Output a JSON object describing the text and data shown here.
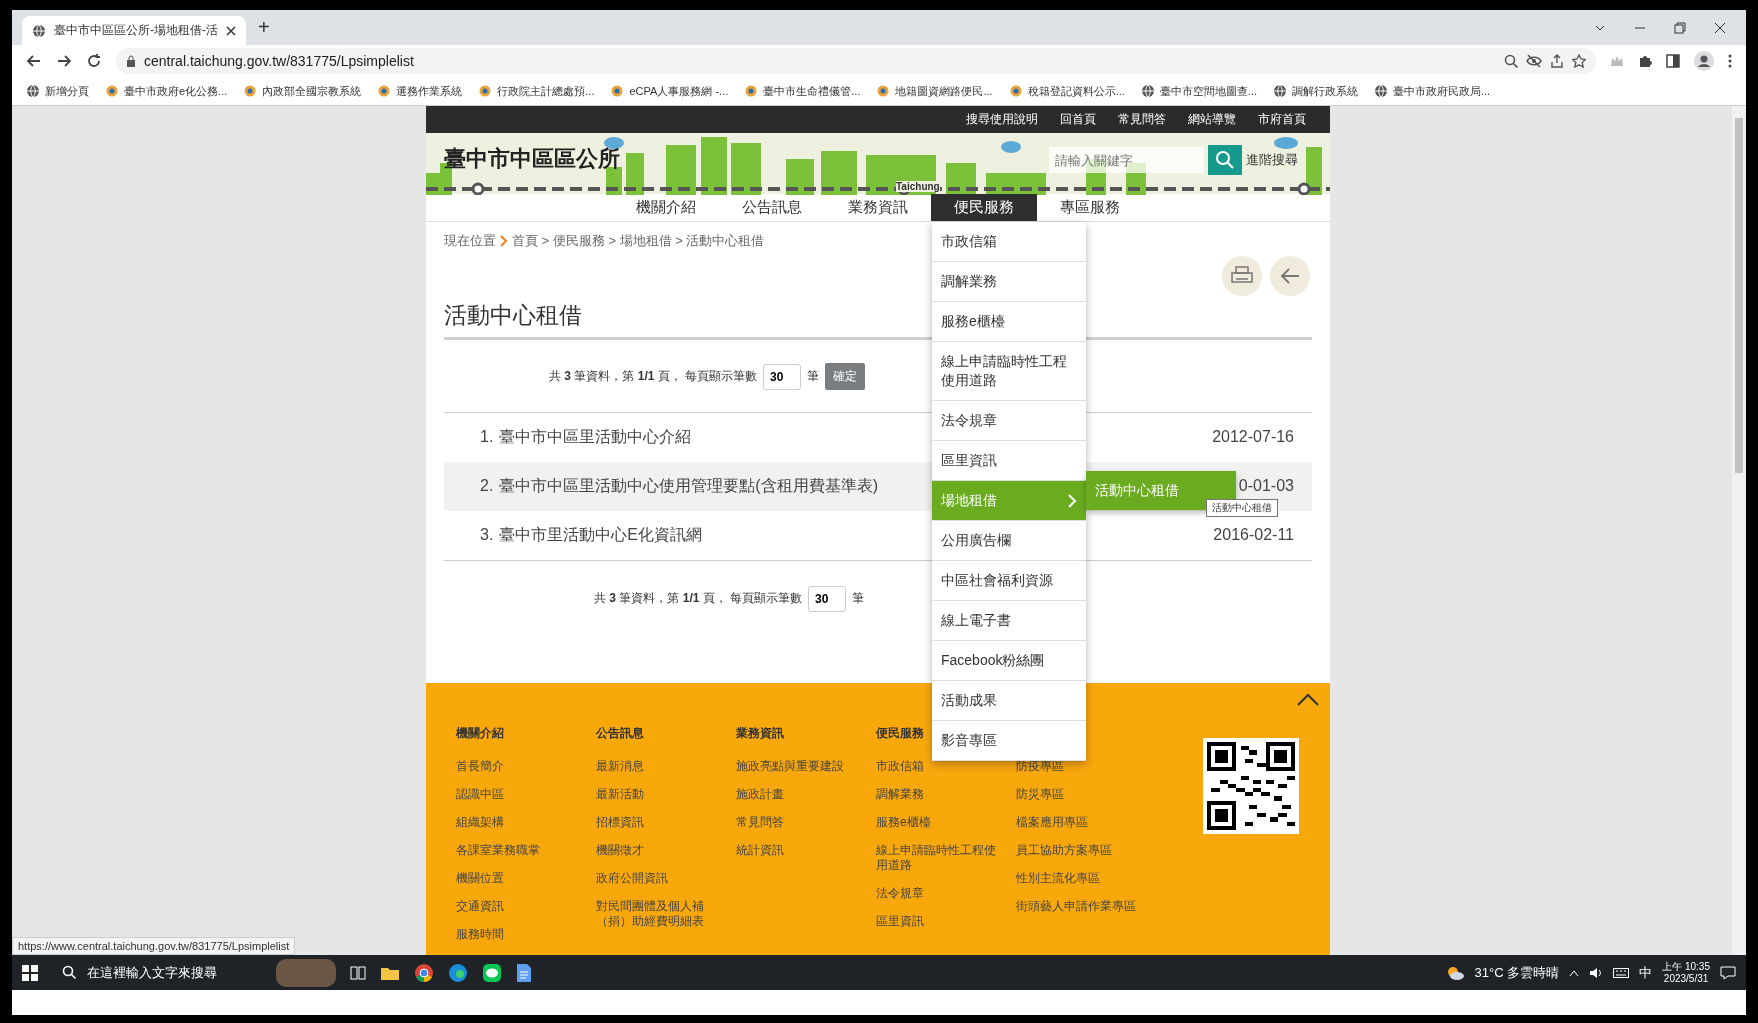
{
  "browser": {
    "tab_title": "臺中市中區區公所-場地租借-活",
    "new_tab": "+",
    "url": "central.taichung.gov.tw/831775/Lpsimplelist",
    "bookmarks": [
      {
        "label": "新增分頁",
        "kind": "globe"
      },
      {
        "label": "臺中市政府e化公務...",
        "kind": "logo"
      },
      {
        "label": "內政部全國宗教系統",
        "kind": "logo"
      },
      {
        "label": "選務作業系統",
        "kind": "logo"
      },
      {
        "label": "行政院主計總處預...",
        "kind": "logo"
      },
      {
        "label": "eCPA人事服務網 -...",
        "kind": "logo"
      },
      {
        "label": "臺中市生命禮儀管...",
        "kind": "logo"
      },
      {
        "label": "地籍圖資網路便民...",
        "kind": "logo"
      },
      {
        "label": "稅籍登記資料公示...",
        "kind": "logo"
      },
      {
        "label": "臺中市空間地圖查...",
        "kind": "globe"
      },
      {
        "label": "調解行政系統",
        "kind": "globe"
      },
      {
        "label": "臺中市政府民政局...",
        "kind": "globe"
      }
    ],
    "status_url": "https://www.central.taichung.gov.tw/831775/Lpsimplelist"
  },
  "site": {
    "top_links": [
      "搜尋使用說明",
      "回首頁",
      "常見問答",
      "網站導覽",
      "市府首頁"
    ],
    "title": "臺中市中區區公所",
    "rail_label": "Taichung",
    "search": {
      "placeholder": "請輸入關鍵字"
    },
    "advanced_search": "進階搜尋",
    "nav": [
      {
        "label": "機關介紹",
        "selected": false
      },
      {
        "label": "公告訊息",
        "selected": false
      },
      {
        "label": "業務資訊",
        "selected": false
      },
      {
        "label": "便民服務",
        "selected": true
      },
      {
        "label": "專區服務",
        "selected": false
      }
    ],
    "dropdown": [
      {
        "label": "市政信箱",
        "selected": false
      },
      {
        "label": "調解業務",
        "selected": false
      },
      {
        "label": "服務e櫃檯",
        "selected": false
      },
      {
        "label": "線上申請臨時性工程使用道路",
        "selected": false
      },
      {
        "label": "法令規章",
        "selected": false
      },
      {
        "label": "區里資訊",
        "selected": false
      },
      {
        "label": "場地租借",
        "selected": true,
        "submenu": [
          "活動中心租借"
        ],
        "tooltip": "活動中心租借"
      },
      {
        "label": "公用廣告欄",
        "selected": false
      },
      {
        "label": "中區社會福利資源",
        "selected": false
      },
      {
        "label": "線上電子書",
        "selected": false
      },
      {
        "label": "Facebook粉絲團",
        "selected": false
      },
      {
        "label": "活動成果",
        "selected": false
      },
      {
        "label": "影音專區",
        "selected": false
      }
    ],
    "breadcrumb": {
      "label": "現在位置",
      "path": "首頁 > 便民服務 > 場地租借 > 活動中心租借"
    },
    "page_title": "活動中心租借",
    "pager_top": {
      "summary": "共 **3** 筆資料，第 **1/1** 頁， 每頁顯示筆數",
      "page_size": "30",
      "unit": "筆",
      "confirm": "確定"
    },
    "rows": [
      {
        "number": "1.",
        "title": "臺中市中區里活動中心介紹",
        "date": "2012-07-16",
        "shaded": false
      },
      {
        "number": "2.",
        "title": "臺中市中區里活動中心使用管理要點(含租用費基準表)",
        "date": "0-01-03",
        "shaded": true
      },
      {
        "number": "3.",
        "title": "臺中市里活動中心E化資訊網",
        "date": "2016-02-11",
        "shaded": false
      }
    ],
    "pager_bottom": {
      "summary": "共 **3** 筆資料，第 **1/1** 頁， 每頁顯示筆數",
      "page_size": "30",
      "unit": "筆"
    },
    "footer": {
      "columns": [
        {
          "heading": "機關介紹",
          "items": [
            "首長簡介",
            "認識中區",
            "組織架構",
            "各課室業務職掌",
            "機關位置",
            "交通資訊",
            "服務時間"
          ]
        },
        {
          "heading": "公告訊息",
          "items": [
            "最新消息",
            "最新活動",
            "招標資訊",
            "機關徵才",
            "政府公開資訊",
            "對民間團體及個人補（捐）助經費明細表"
          ]
        },
        {
          "heading": "業務資訊",
          "items": [
            "施政亮點與重要建設",
            "施政計畫",
            "常見問答",
            "統計資訊"
          ]
        },
        {
          "heading": "便民服務",
          "items": [
            "市政信箱",
            "調解業務",
            "服務e櫃檯",
            "線上申請臨時性工程使用道路",
            "法令規章",
            "區里資訊"
          ]
        },
        {
          "items": [
            "防疫專區",
            "防災專區",
            "檔案應用專區",
            "員工協助方案專區",
            "性別主流化專區",
            "街頭藝人申請作業專區"
          ]
        }
      ]
    }
  },
  "taskbar": {
    "search_placeholder": "在這裡輸入文字來搜尋",
    "weather": "31°C 多雲時晴",
    "ime": "中",
    "time": "上午 10:35",
    "date": "2023/5/31"
  }
}
